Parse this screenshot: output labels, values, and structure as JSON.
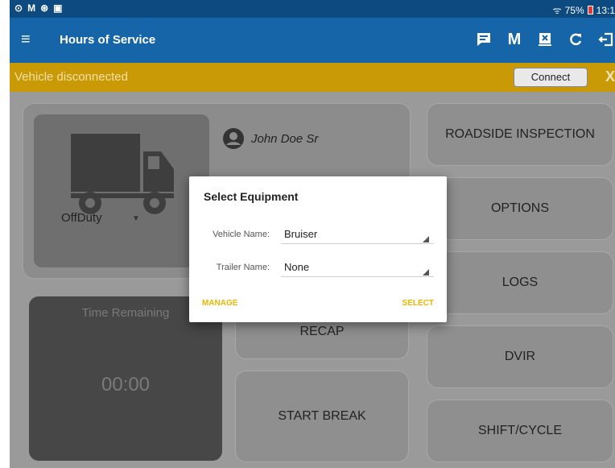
{
  "statusbar": {
    "left_icons": [
      "location-icon",
      "gmail-icon",
      "sync-icon",
      "sim-icon"
    ],
    "mail_glyph": "M",
    "battery": "75%",
    "time": "13:1"
  },
  "appbar": {
    "title": "Hours of Service",
    "message_icon": "message-icon",
    "m_label": "M",
    "actions": [
      "message-icon",
      "m-icon",
      "vehicle-icon",
      "refresh-icon",
      "logout-icon"
    ]
  },
  "banner": {
    "message": "Vehicle disconnected",
    "connect_label": "Connect",
    "close_label": "X"
  },
  "driver": {
    "name": "John Doe Sr"
  },
  "duty": {
    "status": "OffDuty"
  },
  "buttons": {
    "roadside": "ROADSIDE INSPECTION",
    "options": "OPTIONS",
    "logs": "LOGS",
    "dvir": "DVIR",
    "shift": "SHIFT/CYCLE",
    "recap": "RECAP",
    "start_break": "START BREAK"
  },
  "time": {
    "label": "Time Remaining",
    "value": "00:00"
  },
  "dialog": {
    "title": "Select Equipment",
    "vehicle_label": "Vehicle Name:",
    "vehicle_value": "Bruiser",
    "trailer_label": "Trailer Name:",
    "trailer_value": "None",
    "manage": "MANAGE",
    "select": "SELECT"
  },
  "colors": {
    "appbar": "#1565a8",
    "statusbar": "#0d4a80",
    "banner": "#c99a06",
    "accent": "#f0b400"
  }
}
